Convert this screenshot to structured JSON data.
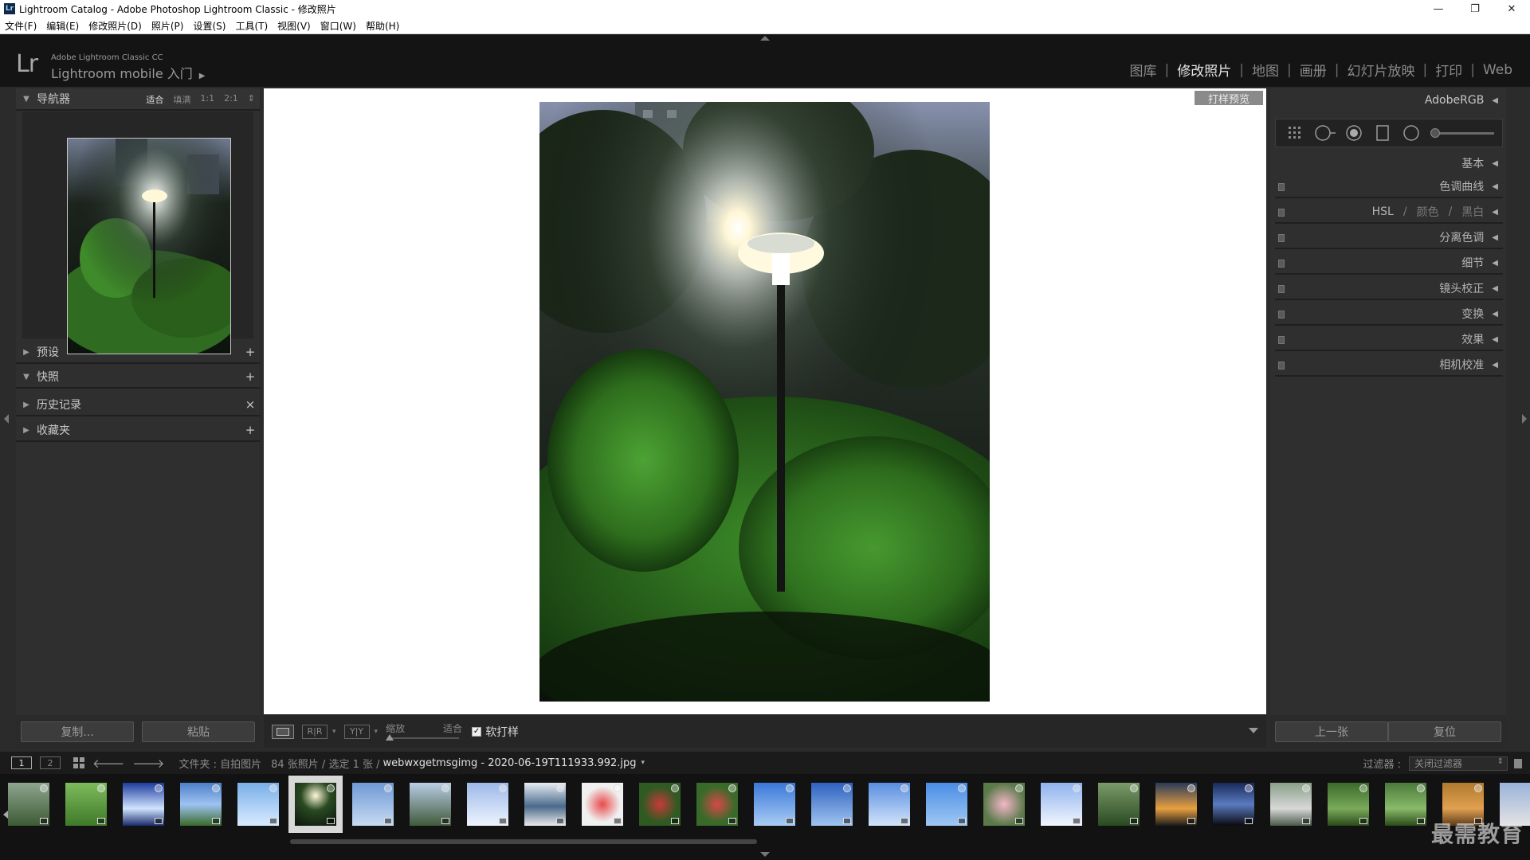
{
  "window": {
    "title": "Lightroom Catalog - Adobe Photoshop Lightroom Classic - 修改照片",
    "app_icon_text": "Lr",
    "controls": {
      "minimize": "—",
      "restore": "❐",
      "close": "✕"
    }
  },
  "menu": [
    "文件(F)",
    "编辑(E)",
    "修改照片(D)",
    "照片(P)",
    "设置(S)",
    "工具(T)",
    "视图(V)",
    "窗口(W)",
    "帮助(H)"
  ],
  "identity": {
    "logo": "Lr",
    "small": "Adobe Lightroom Classic CC",
    "main": "Lightroom mobile 入门",
    "caret": "▶"
  },
  "modules": {
    "items": [
      "图库",
      "修改照片",
      "地图",
      "画册",
      "幻灯片放映",
      "打印",
      "Web"
    ],
    "active": "修改照片",
    "separator": "|"
  },
  "left_panel": {
    "navigator": {
      "title": "导航器",
      "zoom_options": [
        "适合",
        "填满",
        "1:1",
        "2:1"
      ],
      "active_zoom": "适合",
      "zoom_caret": "⇕"
    },
    "presets": {
      "title": "预设",
      "action": "+"
    },
    "snapshots": {
      "title": "快照",
      "action": "+"
    },
    "history": {
      "title": "历史记录",
      "action": "×"
    },
    "collections": {
      "title": "收藏夹",
      "action": "+"
    }
  },
  "soft_proof_label": "打样预览",
  "right_panel": {
    "profile": "AdobeRGB",
    "sections": {
      "basic": "基本",
      "tone_curve": "色调曲线",
      "hsl_a": "HSL",
      "hsl_sep": "/",
      "hsl_b": "颜色",
      "hsl_c": "黑白",
      "split_toning": "分离色调",
      "detail": "细节",
      "lens_corrections": "镜头校正",
      "transform": "变换",
      "effects": "效果",
      "camera_calibration": "相机校准"
    },
    "collapse_glyph": "◀"
  },
  "buttons": {
    "copy": "复制...",
    "paste": "粘贴",
    "previous": "上一张",
    "reset": "复位"
  },
  "toolbar": {
    "compare_a": "R|R",
    "compare_b": "Y|Y",
    "caret": "▾",
    "zoom_label": "缩放",
    "zoom_value": "适合",
    "soft_proof": "软打样",
    "soft_proof_checked": "✓"
  },
  "filmstrip_header": {
    "screen1": "1",
    "screen2": "2",
    "back": "🡐",
    "forward": "🡒",
    "source": "文件夹 : 自拍图片",
    "count": "84 张照片 / 选定 1 张 /",
    "filename": "webwxgetmsgimg - 2020-06-19T111933.992.jpg",
    "filename_caret": "▾",
    "filter_label": "过滤器 :",
    "filter_value": "关闭过滤器",
    "filter_caret": "⇕"
  },
  "watermark": "最需教育",
  "colors": {
    "panel_bg": "#2f2f2f",
    "header_bg": "#141414",
    "filmstrip_bg": "#121212",
    "active_module": "#e6e6e6",
    "inactive_text": "#8a8a8a"
  },
  "icons": {
    "window_minimize": "minimize-icon",
    "window_restore": "restore-icon",
    "window_close": "close-icon",
    "grid": "grid-view-icon",
    "crop": "crop-overlay-icon",
    "spot": "spot-removal-icon",
    "redeye": "red-eye-icon",
    "gradient": "graduated-filter-icon",
    "radial": "radial-filter-icon",
    "brush": "adjustment-brush-icon"
  }
}
